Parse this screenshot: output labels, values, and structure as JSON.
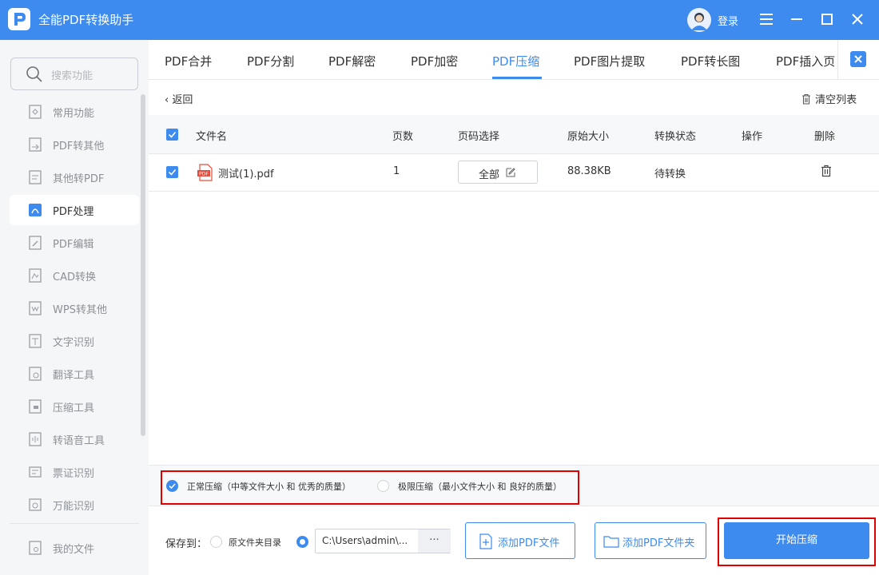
{
  "app": {
    "title": "全能PDF转换助手",
    "login_label": "登录"
  },
  "colors": {
    "accent": "#3d8bee",
    "highlight": "#e00000",
    "sidebar_bg": "#f5f6f8"
  },
  "sidebar": {
    "search_placeholder": "搜索功能",
    "items": [
      {
        "label": "常用功能",
        "icon": "star-doc-icon"
      },
      {
        "label": "PDF转其他",
        "icon": "pdf-convert-icon"
      },
      {
        "label": "其他转PDF",
        "icon": "to-pdf-icon"
      },
      {
        "label": "PDF处理",
        "icon": "pdf-process-icon",
        "active": true
      },
      {
        "label": "PDF编辑",
        "icon": "pdf-edit-icon"
      },
      {
        "label": "CAD转换",
        "icon": "cad-icon"
      },
      {
        "label": "WPS转其他",
        "icon": "wps-icon"
      },
      {
        "label": "文字识别",
        "icon": "ocr-icon"
      },
      {
        "label": "翻译工具",
        "icon": "translate-icon"
      },
      {
        "label": "压缩工具",
        "icon": "zip-icon"
      },
      {
        "label": "转语音工具",
        "icon": "voice-icon"
      },
      {
        "label": "票证识别",
        "icon": "ticket-icon"
      },
      {
        "label": "万能识别",
        "icon": "scan-icon"
      }
    ],
    "my_files": "我的文件"
  },
  "tabs": [
    "PDF合并",
    "PDF分割",
    "PDF解密",
    "PDF加密",
    "PDF压缩",
    "PDF图片提取",
    "PDF转长图",
    "PDF插入页"
  ],
  "active_tab": "PDF压缩",
  "toolbar": {
    "back": "返回",
    "clear_list": "清空列表"
  },
  "table": {
    "headers": {
      "filename": "文件名",
      "pages": "页数",
      "page_select": "页码选择",
      "size": "原始大小",
      "status": "转换状态",
      "action": "操作",
      "delete": "删除"
    },
    "rows": [
      {
        "filename": "测试(1).pdf",
        "pages": "1",
        "page_select": "全部",
        "size": "88.38KB",
        "status": "待转换"
      }
    ]
  },
  "compression": {
    "normal": {
      "label": "正常压缩",
      "desc": "（中等文件大小 和 优秀的质量）",
      "selected": true
    },
    "extreme": {
      "label": "极限压缩",
      "desc": "（最小文件大小 和 良好的质量）",
      "selected": false
    }
  },
  "bottom": {
    "save_to": "保存到：",
    "original_dir": "原文件夹目录",
    "path": "C:\\Users\\admin\\...",
    "path_more": "···",
    "add_pdf_file": "添加PDF文件",
    "add_pdf_folder": "添加PDF文件夹",
    "start": "开始压缩"
  }
}
